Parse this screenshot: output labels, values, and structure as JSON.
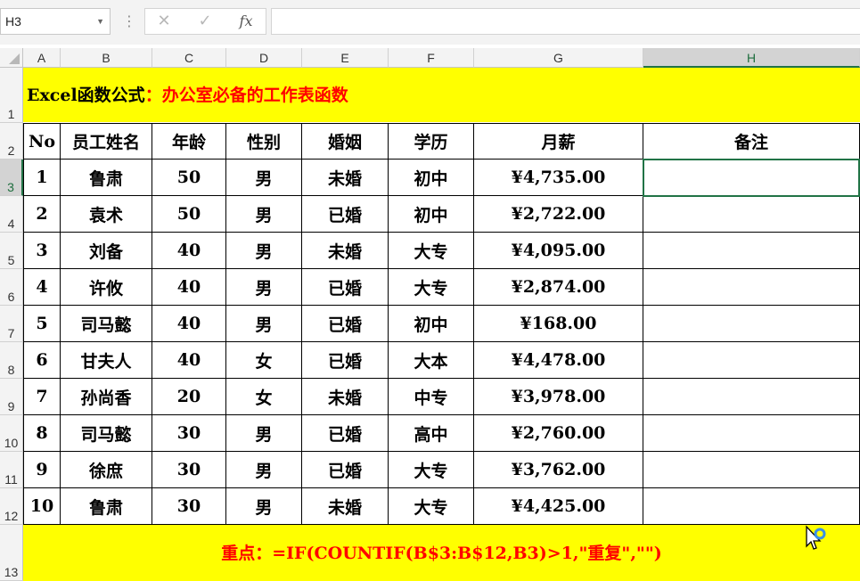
{
  "formula_bar": {
    "name_box": "H3",
    "cancel_glyph": "✕",
    "enter_glyph": "✓",
    "fx_label": "fx",
    "formula": ""
  },
  "columns": [
    "A",
    "B",
    "C",
    "D",
    "E",
    "F",
    "G",
    "H"
  ],
  "rows": [
    "1",
    "2",
    "3",
    "4",
    "5",
    "6",
    "7",
    "8",
    "9",
    "10",
    "11",
    "12",
    "13"
  ],
  "title": {
    "part1": "Excel函数公式",
    "part2": "：办公室必备的工作表函数"
  },
  "table": {
    "headers": [
      "No",
      "员工姓名",
      "年龄",
      "性别",
      "婚姻",
      "学历",
      "月薪",
      "备注"
    ],
    "rows": [
      [
        "1",
        "鲁肃",
        "50",
        "男",
        "未婚",
        "初中",
        "¥4,735.00",
        ""
      ],
      [
        "2",
        "袁术",
        "50",
        "男",
        "已婚",
        "初中",
        "¥2,722.00",
        ""
      ],
      [
        "3",
        "刘备",
        "40",
        "男",
        "未婚",
        "大专",
        "¥4,095.00",
        ""
      ],
      [
        "4",
        "许攸",
        "40",
        "男",
        "已婚",
        "大专",
        "¥2,874.00",
        ""
      ],
      [
        "5",
        "司马懿",
        "40",
        "男",
        "已婚",
        "初中",
        "¥168.00",
        ""
      ],
      [
        "6",
        "甘夫人",
        "40",
        "女",
        "已婚",
        "大本",
        "¥4,478.00",
        ""
      ],
      [
        "7",
        "孙尚香",
        "20",
        "女",
        "未婚",
        "中专",
        "¥3,978.00",
        ""
      ],
      [
        "8",
        "司马懿",
        "30",
        "男",
        "已婚",
        "高中",
        "¥2,760.00",
        ""
      ],
      [
        "9",
        "徐庶",
        "30",
        "男",
        "已婚",
        "大专",
        "¥3,762.00",
        ""
      ],
      [
        "10",
        "鲁肃",
        "30",
        "男",
        "未婚",
        "大专",
        "¥4,425.00",
        ""
      ]
    ]
  },
  "footer": "重点：=IF(COUNTIF(B$3:B$12,B3)>1,\"重复\",\"\")",
  "colors": {
    "band": "#ffff00",
    "accent_text": "#ff0000",
    "selection": "#217346"
  }
}
